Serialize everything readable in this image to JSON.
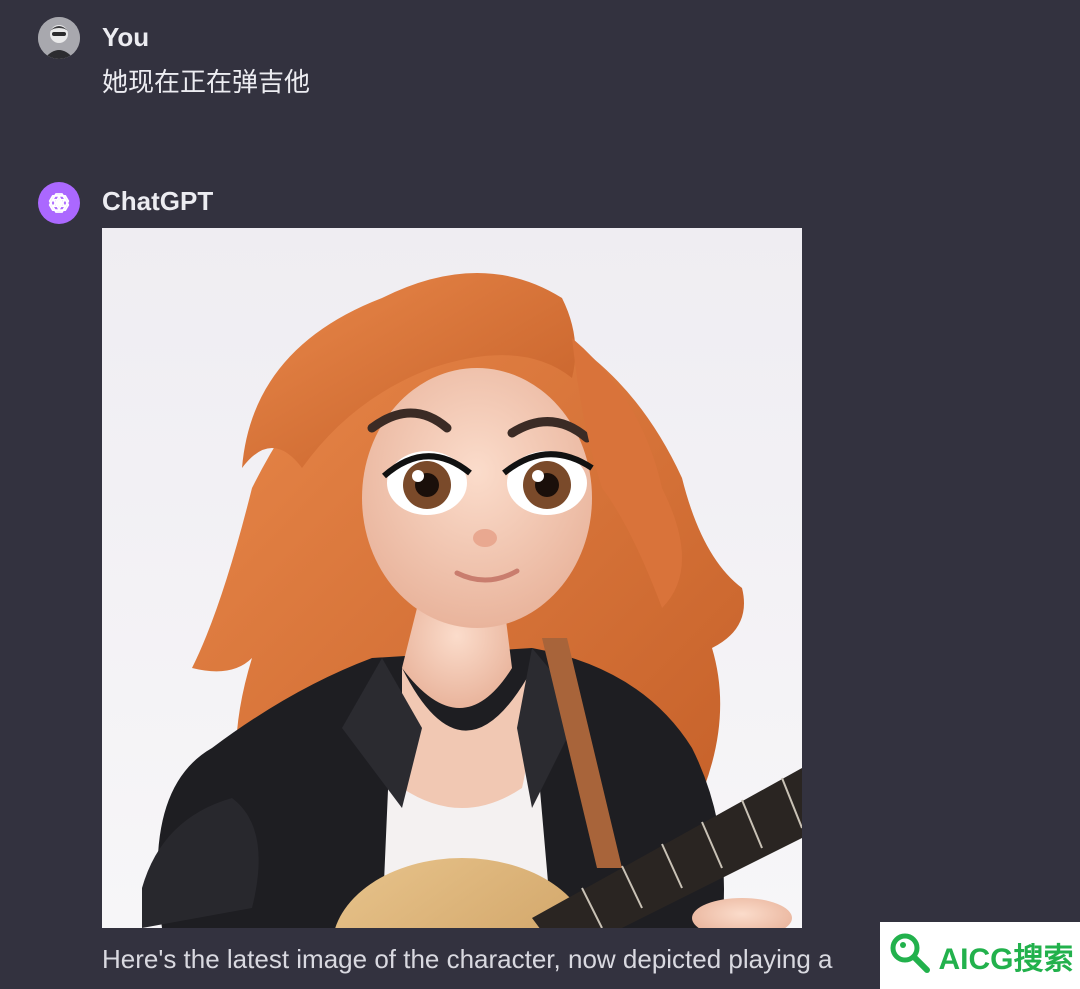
{
  "user_message": {
    "author": "You",
    "text": "她现在正在弹吉他",
    "avatar_icon": "user-avatar-icon"
  },
  "assistant_message": {
    "author": "ChatGPT",
    "avatar_icon": "openai-logo-icon",
    "avatar_color": "#ab68ff",
    "image_icon": "generated-image-redhead-guitar",
    "reply_text": "Here's the latest image of the character, now depicted playing a"
  },
  "watermark": {
    "text": "AICG搜索",
    "color": "#22b14c",
    "icon": "magnifier-icon"
  },
  "colors": {
    "background": "#33323f",
    "text": "#ececf1"
  }
}
